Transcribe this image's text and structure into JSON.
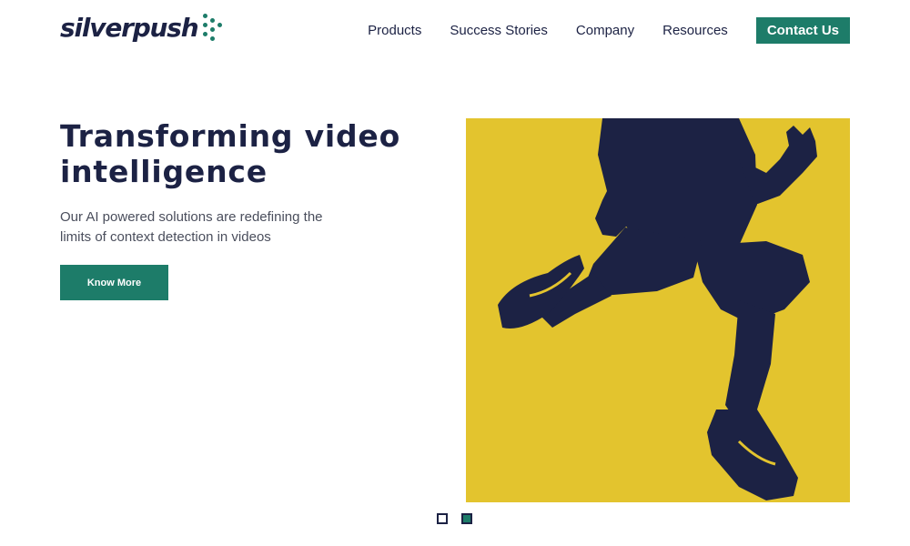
{
  "brand": {
    "name": "silverpush",
    "accent_color": "#1d7c69",
    "text_color": "#1c2244",
    "hero_bg_color": "#e3c42e"
  },
  "nav": {
    "items": [
      {
        "label": "Products"
      },
      {
        "label": "Success Stories"
      },
      {
        "label": "Company"
      },
      {
        "label": "Resources"
      }
    ],
    "contact_label": "Contact Us"
  },
  "hero": {
    "title_line1": "Transforming video",
    "title_line2": "intelligence",
    "subtitle": "Our AI powered solutions are redefining the limits of context detection in videos",
    "cta_label": "Know More",
    "image_icon": "jumping-person-silhouette"
  },
  "carousel": {
    "slide_count": 2,
    "active_index": 1
  }
}
